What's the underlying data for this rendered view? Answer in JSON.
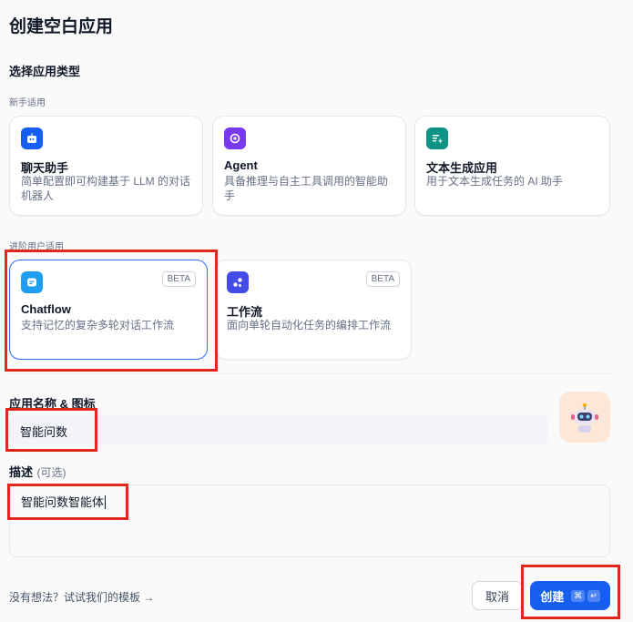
{
  "dialog": {
    "title": "创建空白应用",
    "section_app_type": "选择应用类型"
  },
  "groups": {
    "beginner": "新手适用",
    "advanced": "进阶用户适用"
  },
  "beginner_cards": [
    {
      "name": "聊天助手",
      "desc": "简单配置即可构建基于 LLM 的对话机器人",
      "icon": "chat-bot-icon",
      "color": "#155eef"
    },
    {
      "name": "Agent",
      "desc": "具备推理与自主工具调用的智能助手",
      "icon": "agent-icon",
      "color": "#7839ee"
    },
    {
      "name": "文本生成应用",
      "desc": "用于文本生成任务的 AI 助手",
      "icon": "text-generation-icon",
      "color": "#0e9384"
    }
  ],
  "advanced_cards": [
    {
      "name": "Chatflow",
      "desc": "支持记忆的复杂多轮对话工作流",
      "badge": "BETA",
      "icon": "chatflow-icon",
      "color": "#1e9df1",
      "selected": true
    },
    {
      "name": "工作流",
      "desc": "面向单轮自动化任务的编排工作流",
      "badge": "BETA",
      "icon": "workflow-icon",
      "color": "#444ce7",
      "selected": false
    }
  ],
  "form": {
    "name_label": "应用名称 & 图标",
    "name_value": "智能问数",
    "desc_label": "描述",
    "desc_optional": "(可选)",
    "desc_value": "智能问数智能体",
    "avatar_icon": "robot-avatar-icon"
  },
  "footer": {
    "template_link": "没有想法？试试我们的模板 →",
    "cancel_label": "取消",
    "create_label": "创建",
    "create_kbd_1": "⌘",
    "create_kbd_2": "↵"
  }
}
